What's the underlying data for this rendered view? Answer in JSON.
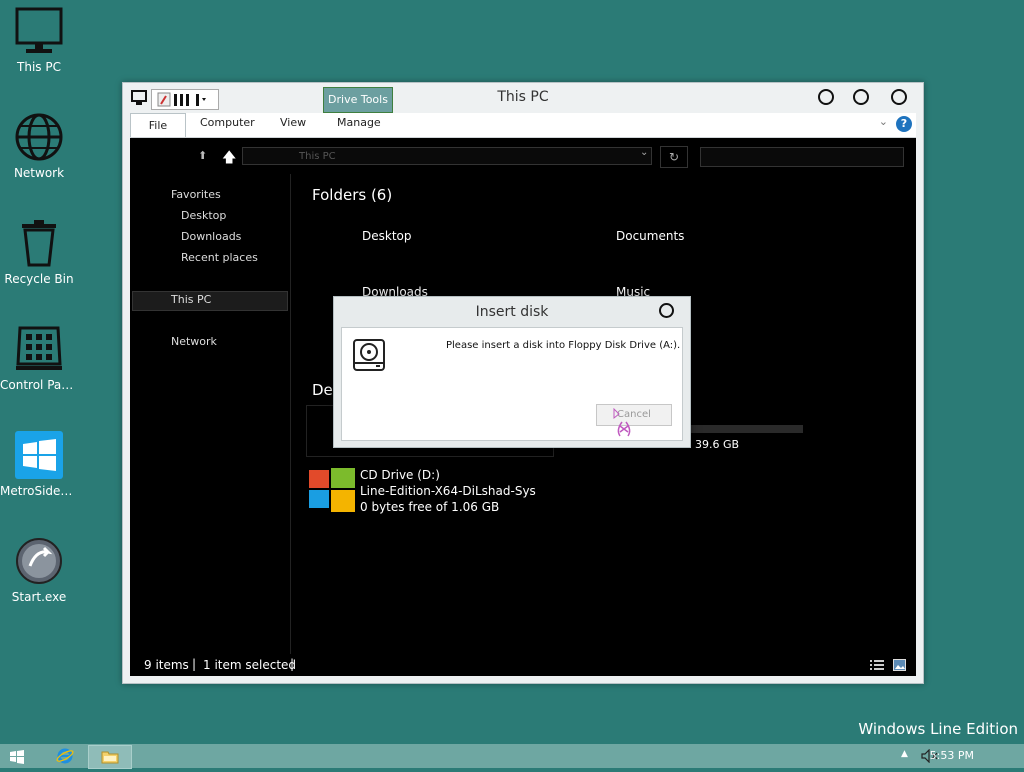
{
  "desktop": {
    "icons": [
      {
        "label": "This PC",
        "icon": "monitor-icon"
      },
      {
        "label": "Network",
        "icon": "globe-icon"
      },
      {
        "label": "Recycle Bin",
        "icon": "recycle-bin-icon"
      },
      {
        "label": "Control Panel",
        "icon": "control-panel-icon"
      },
      {
        "label": "MetroSideb...",
        "icon": "windows-tile-icon"
      },
      {
        "label": "Start.exe",
        "icon": "start-orb-icon"
      }
    ],
    "watermark": "Windows Line Edition"
  },
  "window": {
    "title": "This PC",
    "context_tab": "Drive Tools",
    "ribbon_tabs": [
      "File",
      "Computer",
      "View",
      "Manage"
    ],
    "address": "This PC",
    "nav_pane": {
      "favorites_header": "Favorites",
      "favorites": [
        "Desktop",
        "Downloads",
        "Recent places"
      ],
      "this_pc": "This PC",
      "network": "Network"
    },
    "content": {
      "folders_header": "Folders (6)",
      "folders": [
        "Desktop",
        "Documents",
        "Downloads",
        "Music"
      ],
      "devices_header_partial": "Dev",
      "c_drive_free_partial": "39.6 GB",
      "cd_drive": {
        "name": "CD Drive (D:)",
        "label": "Line-Edition-X64-DiLshad-Sys",
        "free": "0 bytes free of 1.06 GB"
      }
    },
    "status": {
      "items": "9 items",
      "selected": "1 item selected"
    }
  },
  "dialog": {
    "title": "Insert disk",
    "message": "Please insert a disk into Floppy Disk Drive (A:).",
    "cancel_label": "Cancel"
  },
  "taskbar": {
    "time": "5:53 PM"
  },
  "colors": {
    "desktop": "#2b7b76",
    "taskbar": "#6ea7a2",
    "context_tab": "#6c9fa0"
  }
}
